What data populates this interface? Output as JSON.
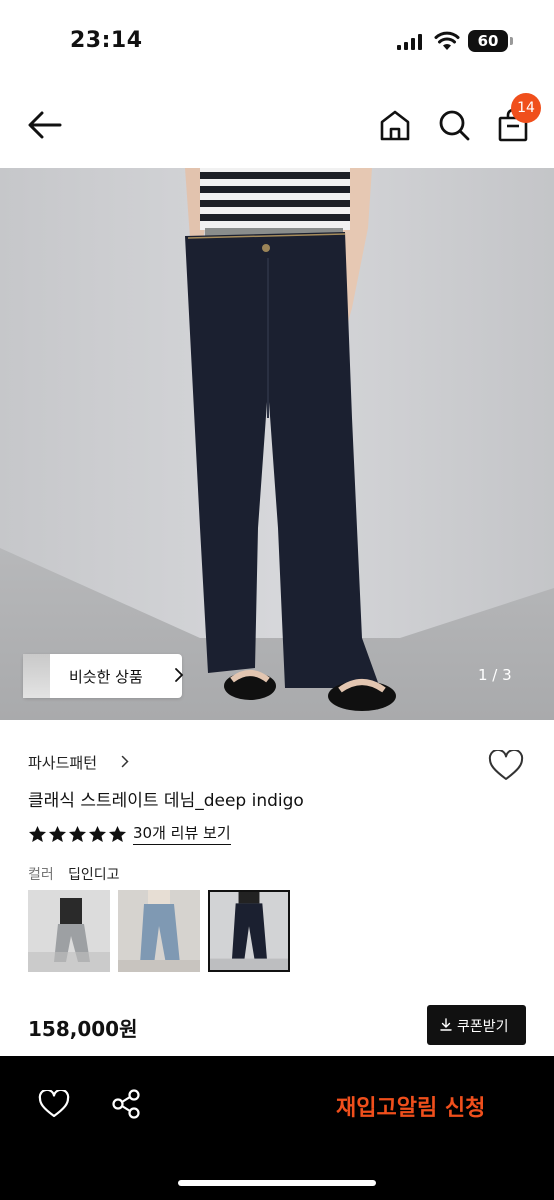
{
  "status": {
    "time": "23:14",
    "battery": "60"
  },
  "header": {
    "cart_count": "14"
  },
  "gallery": {
    "similar_label": "비슷한 상품",
    "pager": "1 / 3"
  },
  "product": {
    "brand": "파사드패턴",
    "name": "클래식 스트레이트 데님_deep indigo",
    "rating_stars": 5,
    "review_link": "30개 리뷰 보기",
    "color_label": "컬러",
    "color_value": "딥인디고",
    "price": "158,000원",
    "coupon_label": "쿠폰받기"
  },
  "bottom_bar": {
    "restock_label": "재입고알림 신청"
  },
  "colors": {
    "accent": "#f04f1c",
    "dark": "#111111",
    "bottom_bar_bg": "#000000"
  },
  "icons": [
    "back-arrow-icon",
    "home-icon",
    "search-icon",
    "shopping-bag-icon",
    "chevron-right-icon",
    "heart-icon",
    "star-icon",
    "download-icon",
    "share-icon"
  ]
}
